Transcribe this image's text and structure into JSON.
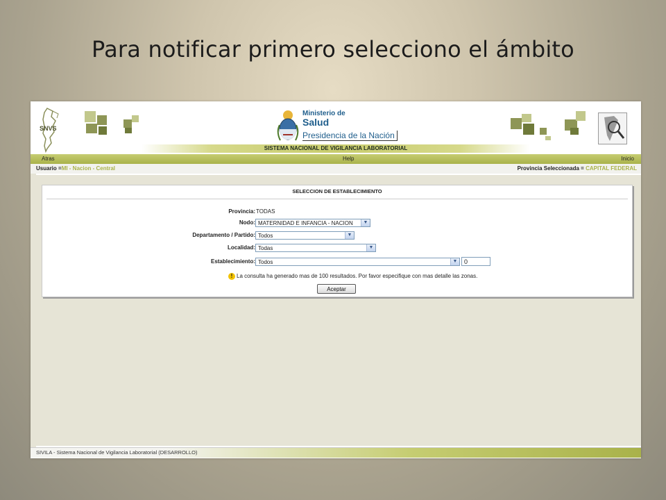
{
  "slide": {
    "title": "Para notificar primero selecciono el ámbito"
  },
  "header": {
    "snvs_logo_text": "SNVS",
    "ministry_line1": "Ministerio de",
    "ministry_line2": "Salud",
    "ministry_line3": "Presidencia de la Nación",
    "system_name": "SISTEMA NACIONAL DE VIGILANCIA LABORATORIAL",
    "brand_colors": {
      "olive": "#a9b24a",
      "light_green": "#c6cd72",
      "ministry_blue": "#1f5e8c"
    }
  },
  "nav": {
    "back": "Atras",
    "help": "Help",
    "home": "Inicio"
  },
  "user_bar": {
    "user_label": "Usuario =",
    "user_value": "MI - Nacion - Central",
    "province_label": "Provincia Seleccionada = ",
    "province_value": "CAPITAL FEDERAL"
  },
  "form": {
    "title": "SELECCION DE ESTABLECIMIENTO",
    "provincia_label": "Provincia:",
    "provincia_value": "TODAS",
    "nodo_label": "Nodo:",
    "nodo_value": "MATERNIDAD E INFANCIA - NACION",
    "departamento_label": "Departamento / Partido:",
    "departamento_value": "Todos",
    "localidad_label": "Localidad:",
    "localidad_value": "Todas",
    "establecimiento_label": "Establecimiento:",
    "establecimiento_value": "Todos",
    "establecimiento_code": "0",
    "warning_text": "La consulta ha generado mas de 100 resultados. Por favor especifique con mas detalle las zonas.",
    "submit_label": "Aceptar"
  },
  "footer": {
    "text": "SIVILA - Sistema Nacional de Vigilancia Laboratorial (DESARROLLO)"
  }
}
